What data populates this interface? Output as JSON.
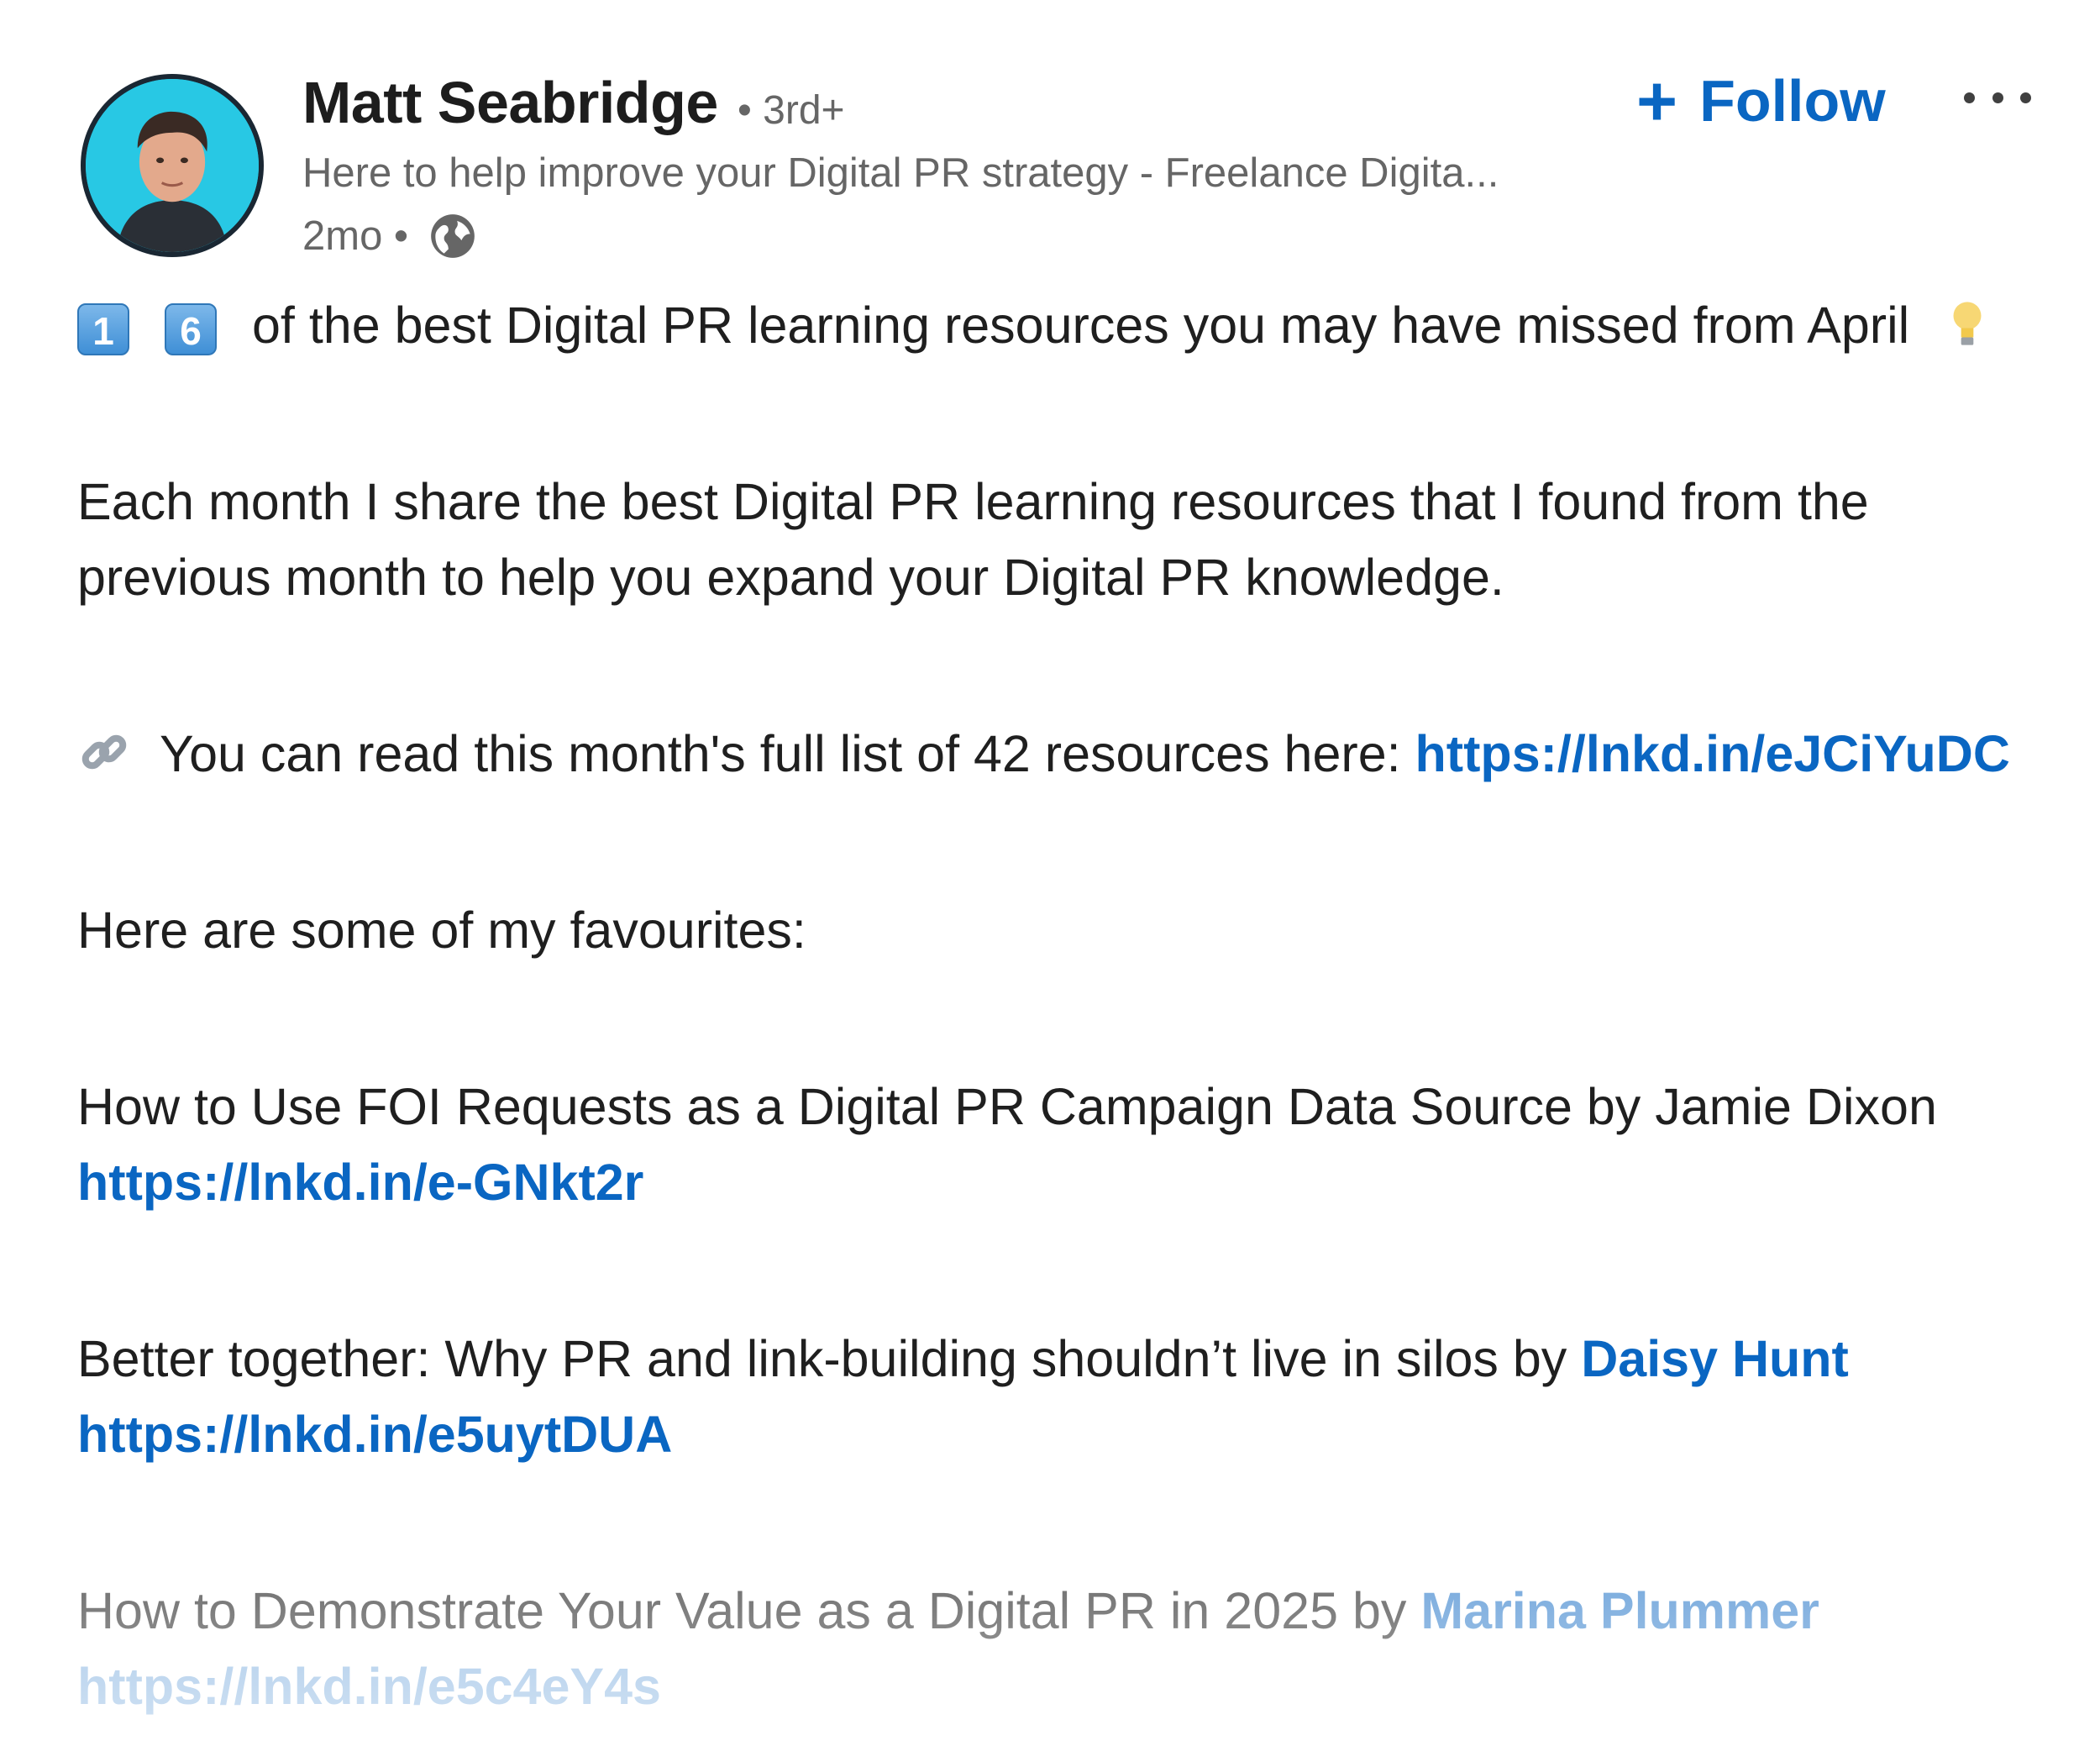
{
  "author": {
    "name": "Matt Seabridge",
    "degree": "• 3rd+",
    "headline": "Here to help improve your Digital PR strategy - Freelance Digita...",
    "time": "2mo •",
    "avatar_icon": "avatar-photo",
    "visibility_icon": "globe-icon"
  },
  "actions": {
    "follow_plus": "+",
    "follow_label": "Follow",
    "more_icon": "more-horizontal-icon"
  },
  "post": {
    "title_badge_1": "1",
    "title_badge_2": "6",
    "title_text": "of the best Digital PR learning resources you may have missed from April",
    "title_emoji": "lightbulb-icon",
    "intro_line_1": "Each month I share the best Digital PR learning resources that I found from the",
    "intro_line_2": "previous month to help you expand your Digital PR knowledge.",
    "list_text": "You can read this month's full list of 42 resources here:",
    "list_link": "https://lnkd.in/eJCiYuDC",
    "list_emoji": "link-icon",
    "favourites_intro": "Here are some of my favourites:",
    "items": [
      {
        "title": "How to Use FOI Requests as a Digital PR Campaign Data Source by Jamie Dixon",
        "mention": "",
        "link": "https://lnkd.in/e-GNkt2r"
      },
      {
        "title": "Better together: Why PR and link-building shouldn’t live in silos by",
        "mention": "Daisy Hunt",
        "link": "https://lnkd.in/e5uytDUA"
      },
      {
        "title": "How to Demonstrate Your Value as a Digital PR in 2025 by",
        "mention": "Marina Plummer",
        "link": "https://lnkd.in/e5c4eY4s"
      }
    ]
  },
  "colors": {
    "link": "#0a66c2",
    "text": "#1f1f1f",
    "muted": "#666666",
    "avatar_bg": "#28c8e4"
  }
}
